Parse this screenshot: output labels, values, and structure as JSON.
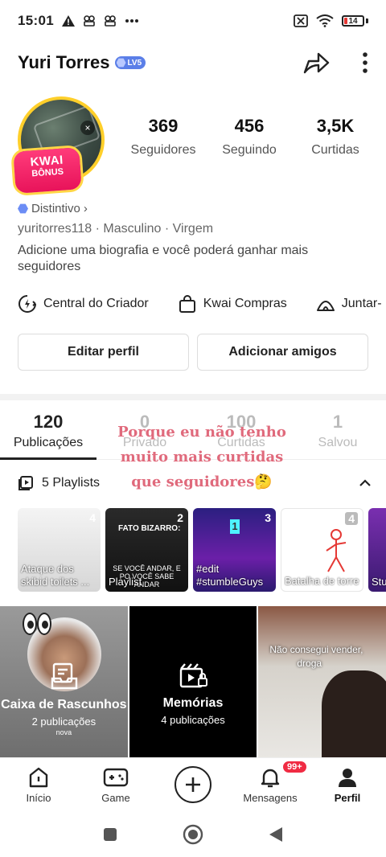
{
  "status_bar": {
    "time": "15:01",
    "battery_level": "14",
    "icons": [
      "warning-icon",
      "app-notification-icon",
      "app-notification-icon",
      "more-dots-icon",
      "no-sim-icon",
      "wifi-icon",
      "battery-icon"
    ]
  },
  "header": {
    "user_name": "Yuri Torres",
    "level_badge": "LV5",
    "share_icon": "share-arrow-icon",
    "more_icon": "more-vertical-icon"
  },
  "avatar": {
    "bonus_line1": "KWAI",
    "bonus_line2": "BÔNUS",
    "close_symbol": "×"
  },
  "stats": [
    {
      "value": "369",
      "label": "Seguidores"
    },
    {
      "value": "456",
      "label": "Seguindo"
    },
    {
      "value": "3,5K",
      "label": "Curtidas"
    }
  ],
  "profile": {
    "distintivo": "Distintivo",
    "distintivo_chevron": "›",
    "meta": "yuritorres118 · Masculino · Virgem",
    "bio": "Adicione uma biografia e você poderá ganhar mais seguidores"
  },
  "shortcuts": [
    {
      "label": "Central do Criador",
      "icon": "creator-center-icon"
    },
    {
      "label": "Kwai Compras",
      "icon": "shopping-bag-icon"
    },
    {
      "label": "Juntar-",
      "icon": "join-tent-icon"
    }
  ],
  "actions": {
    "edit_profile": "Editar perfil",
    "add_friends": "Adicionar amigos"
  },
  "tabs": [
    {
      "count": "120",
      "label": "Publicações"
    },
    {
      "count": "0",
      "label": "Privado"
    },
    {
      "count": "100",
      "label": "Curtidas"
    },
    {
      "count": "1",
      "label": "Salvou"
    }
  ],
  "overlay_caption": {
    "line1": "Porque eu não tenho",
    "line2": "muito mais curtidas",
    "line3": "que seguidores🤔"
  },
  "playlists": {
    "header": "5 Playlists",
    "items": [
      {
        "title": "Ataque dos skibid toilets ...",
        "count": "4"
      },
      {
        "title": "Playlist",
        "count": "2",
        "top_caption": "FATO BIZARRO:",
        "mid_caption": "SE VOCÊ ANDAR, E PO VOCÊ SABE ANDAR"
      },
      {
        "title": "#edit #stumbleGuys",
        "count": "3",
        "counter": "1"
      },
      {
        "title": "Batalha de torre",
        "count": "4"
      },
      {
        "title": "Stu edi",
        "count": ""
      }
    ]
  },
  "grid": {
    "drafts_title": "Caixa de Rascunhos",
    "drafts_sub": "2 publicações",
    "drafts_mini": "nova",
    "memories_title": "Memórias",
    "memories_sub": "4 publicações",
    "video_caption_1": "Não consegui vender,",
    "video_caption_2": "droga"
  },
  "bottom_nav": [
    {
      "label": "Início",
      "icon": "home-icon"
    },
    {
      "label": "Game",
      "icon": "gamepad-icon"
    },
    {
      "label": "",
      "icon": "create-plus-icon"
    },
    {
      "label": "Mensagens",
      "icon": "bell-icon",
      "badge": "99+"
    },
    {
      "label": "Perfil",
      "icon": "person-icon"
    }
  ],
  "colors": {
    "accent_pink": "#e8135a",
    "badge_red": "#f02b43",
    "level_blue": "#5b7fe8",
    "avatar_ring": "#ffcf2a",
    "overlay_text": "#e06a7c"
  }
}
